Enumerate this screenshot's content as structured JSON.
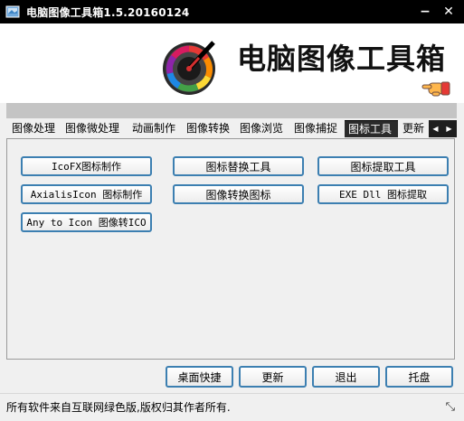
{
  "window": {
    "title": "电脑图像工具箱1.5.20160124",
    "minimize_symbol": "−",
    "close_symbol": "✕"
  },
  "banner": {
    "title": "电脑图像工具箱",
    "logo_icon": "color-picker-dial-icon",
    "hand_icon": "pointing-hand-icon"
  },
  "tabs": [
    {
      "label": "图像处理"
    },
    {
      "label": "图像微处理"
    },
    {
      "label": "动画制作"
    },
    {
      "label": "图像转换"
    },
    {
      "label": "图像浏览"
    },
    {
      "label": "图像捕捉"
    },
    {
      "label": "图标工具",
      "active": true
    },
    {
      "label": "更新"
    }
  ],
  "tab_scroll": {
    "left": "◀",
    "right": "▶"
  },
  "tools": [
    {
      "label": "IcoFX图标制作"
    },
    {
      "label": "图标替换工具"
    },
    {
      "label": "图标提取工具"
    },
    {
      "label": "AxialisIcon 图标制作"
    },
    {
      "label": "图像转换图标"
    },
    {
      "label": "EXE Dll 图标提取"
    },
    {
      "label": "Any to Icon 图像转ICO"
    }
  ],
  "bottom_buttons": {
    "desktop_shortcut": "桌面快捷",
    "update": "更新",
    "exit": "退出",
    "tray": "托盘"
  },
  "status": {
    "text": "所有软件来自互联网绿色版,版权归其作者所有.",
    "grip_symbol": "⤡"
  },
  "colors": {
    "titlebar": "#000000",
    "button_border": "#3c7fb1",
    "active_tab": "#2b2b2b"
  }
}
